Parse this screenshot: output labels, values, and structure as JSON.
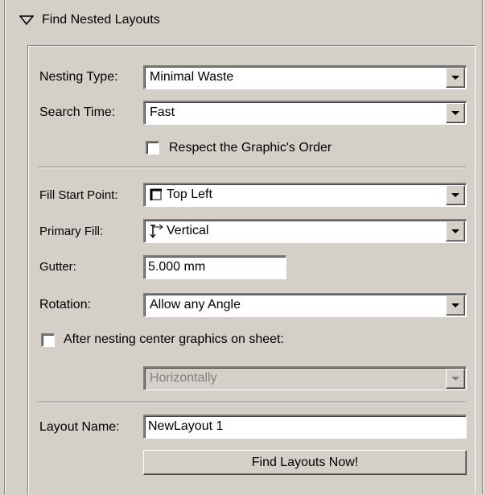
{
  "section": {
    "title": "Find Nested Layouts",
    "expander_icon": "triangle-down-outline"
  },
  "nesting_type": {
    "label": "Nesting Type:",
    "value": "Minimal Waste"
  },
  "search_time": {
    "label": "Search Time:",
    "value": "Fast"
  },
  "respect_order": {
    "label": "Respect the Graphic's Order",
    "checked": false
  },
  "fill_start_point": {
    "label": "Fill Start Point:",
    "value": "Top Left",
    "icon": "top-left-corner-icon"
  },
  "primary_fill": {
    "label": "Primary Fill:",
    "value": "Vertical",
    "icon": "vertical-fill-arrow-icon"
  },
  "gutter": {
    "label": "Gutter:",
    "value": "5.000 mm"
  },
  "rotation": {
    "label": "Rotation:",
    "value": "Allow any Angle"
  },
  "center_graphics": {
    "label": "After nesting center graphics on sheet:",
    "checked": false
  },
  "center_direction": {
    "value": "Horizontally",
    "disabled": true
  },
  "layout_name": {
    "label": "Layout Name:",
    "value": "NewLayout 1"
  },
  "find_button": {
    "label": "Find Layouts Now!"
  },
  "colors": {
    "face": "#d4d0c8",
    "shadow": "#808080",
    "highlight": "#ffffff",
    "disabled_text": "#808080"
  }
}
